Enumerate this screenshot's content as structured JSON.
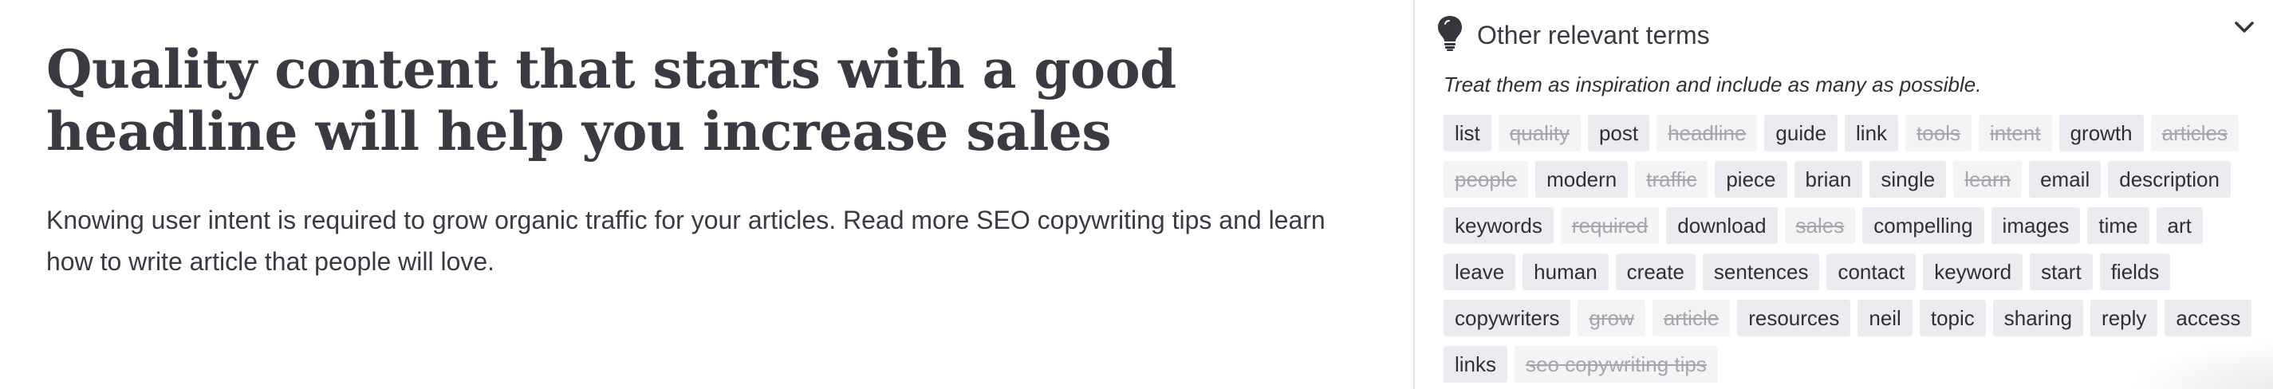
{
  "editor": {
    "headline": "Quality content that starts with a good headline will help you increase sales",
    "intro": "Knowing user intent is required to grow organic traffic for your articles. Read more SEO copywriting tips and learn how to write article that people will love."
  },
  "panel": {
    "title": "Other relevant terms",
    "icon": "lightbulb-icon",
    "collapse_icon": "chevron-down-icon",
    "hint": "Treat them as inspiration and include as many as possible.",
    "terms": [
      {
        "label": "list",
        "used": false
      },
      {
        "label": "quality",
        "used": true
      },
      {
        "label": "post",
        "used": false
      },
      {
        "label": "headline",
        "used": true
      },
      {
        "label": "guide",
        "used": false
      },
      {
        "label": "link",
        "used": false
      },
      {
        "label": "tools",
        "used": true
      },
      {
        "label": "intent",
        "used": true
      },
      {
        "label": "growth",
        "used": false
      },
      {
        "label": "articles",
        "used": true
      },
      {
        "label": "people",
        "used": true
      },
      {
        "label": "modern",
        "used": false
      },
      {
        "label": "traffic",
        "used": true
      },
      {
        "label": "piece",
        "used": false
      },
      {
        "label": "brian",
        "used": false
      },
      {
        "label": "single",
        "used": false
      },
      {
        "label": "learn",
        "used": true
      },
      {
        "label": "email",
        "used": false
      },
      {
        "label": "description",
        "used": false
      },
      {
        "label": "keywords",
        "used": false
      },
      {
        "label": "required",
        "used": true
      },
      {
        "label": "download",
        "used": false
      },
      {
        "label": "sales",
        "used": true
      },
      {
        "label": "compelling",
        "used": false
      },
      {
        "label": "images",
        "used": false
      },
      {
        "label": "time",
        "used": false
      },
      {
        "label": "art",
        "used": false
      },
      {
        "label": "leave",
        "used": false
      },
      {
        "label": "human",
        "used": false
      },
      {
        "label": "create",
        "used": false
      },
      {
        "label": "sentences",
        "used": false
      },
      {
        "label": "contact",
        "used": false
      },
      {
        "label": "keyword",
        "used": false
      },
      {
        "label": "start",
        "used": false
      },
      {
        "label": "fields",
        "used": false
      },
      {
        "label": "copywriters",
        "used": false
      },
      {
        "label": "grow",
        "used": true
      },
      {
        "label": "article",
        "used": true
      },
      {
        "label": "resources",
        "used": false
      },
      {
        "label": "neil",
        "used": false
      },
      {
        "label": "topic",
        "used": false
      },
      {
        "label": "sharing",
        "used": false
      },
      {
        "label": "reply",
        "used": false
      },
      {
        "label": "access",
        "used": false
      },
      {
        "label": "links",
        "used": false
      },
      {
        "label": "seo copywriting tips",
        "used": true
      }
    ]
  }
}
